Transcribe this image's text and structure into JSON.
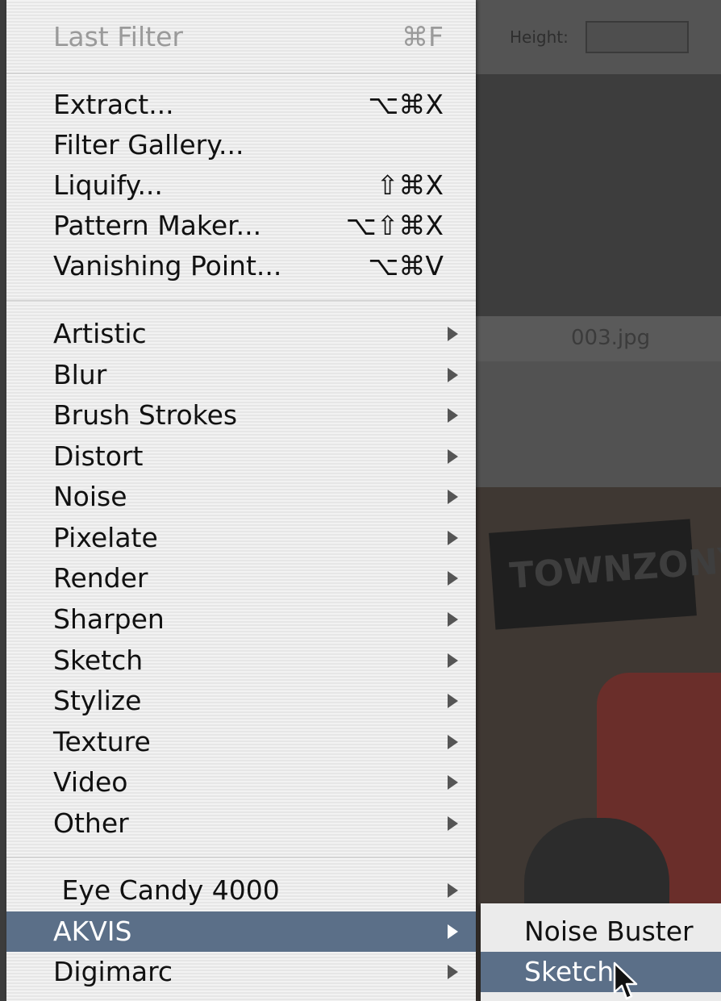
{
  "background": {
    "toolbar_label": "Height:",
    "document_title": "003.jpg",
    "sign_text": "TOWNZONY"
  },
  "menu": {
    "last_filter": {
      "label": "Last Filter",
      "shortcut": "⌘F"
    },
    "group1": [
      {
        "label": "Extract...",
        "shortcut": "⌥⌘X"
      },
      {
        "label": "Filter Gallery...",
        "shortcut": ""
      },
      {
        "label": "Liquify...",
        "shortcut": "⇧⌘X"
      },
      {
        "label": "Pattern Maker...",
        "shortcut": "⌥⇧⌘X"
      },
      {
        "label": "Vanishing Point...",
        "shortcut": "⌥⌘V"
      }
    ],
    "group2": [
      {
        "label": "Artistic"
      },
      {
        "label": "Blur"
      },
      {
        "label": "Brush Strokes"
      },
      {
        "label": "Distort"
      },
      {
        "label": "Noise"
      },
      {
        "label": "Pixelate"
      },
      {
        "label": "Render"
      },
      {
        "label": "Sharpen"
      },
      {
        "label": "Sketch"
      },
      {
        "label": "Stylize"
      },
      {
        "label": "Texture"
      },
      {
        "label": "Video"
      },
      {
        "label": "Other"
      }
    ],
    "group3": [
      {
        "label": " Eye Candy 4000"
      },
      {
        "label": "AKVIS",
        "active": true
      },
      {
        "label": "Digimarc"
      }
    ]
  },
  "submenu": {
    "items": [
      {
        "label": "Noise Buster"
      },
      {
        "label": "Sketch",
        "active": true
      }
    ]
  },
  "colors": {
    "highlight": "#5b6f88",
    "menu_bg": "#ebebeb"
  }
}
